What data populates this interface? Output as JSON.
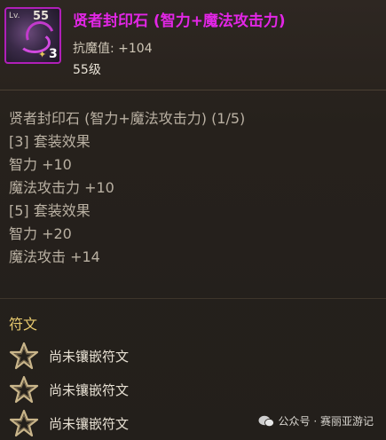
{
  "item": {
    "level_label": "Lv.",
    "level_value": "55",
    "star_count": "3",
    "title": "贤者封印石 (智力+魔法攻击力)",
    "stat_line": "抗魔值: +104",
    "required_level": "55级",
    "title_color": "#e226e6",
    "frame_color": "#b01fb8"
  },
  "set_bonus": {
    "lines": [
      "贤者封印石 (智力+魔法攻击力) (1/5)",
      "[3] 套装效果",
      "智力 +10",
      "魔法攻击力 +10",
      "[5] 套装效果",
      "智力 +20",
      "魔法攻击 +14"
    ]
  },
  "runes": {
    "title": "符文",
    "slots": [
      {
        "label": "尚未镶嵌符文",
        "icon": "rune-star-icon"
      },
      {
        "label": "尚未镶嵌符文",
        "icon": "rune-star-icon"
      },
      {
        "label": "尚未镶嵌符文",
        "icon": "rune-star-icon"
      }
    ]
  },
  "watermark": {
    "text": "公众号 · 赛丽亚游记",
    "icon": "wechat-icon"
  }
}
